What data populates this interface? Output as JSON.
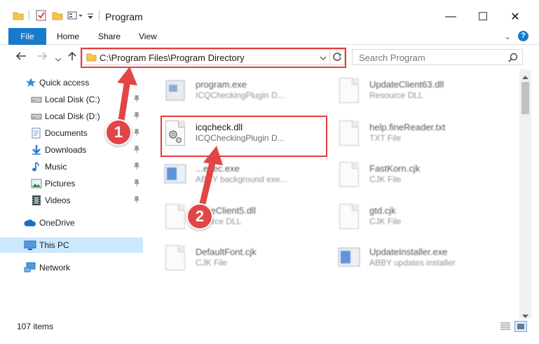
{
  "window": {
    "title": "Program",
    "minimize_glyph": "—",
    "maximize_glyph": "☐",
    "close_glyph": "✕"
  },
  "ribbon": {
    "tabs": [
      "File",
      "Home",
      "Share",
      "View"
    ],
    "help_glyph": "?",
    "expand_glyph": "⌄"
  },
  "address": {
    "path": "C:\\Program Files\\Program Directory",
    "search_placeholder": "Search Program"
  },
  "sidebar": {
    "items": [
      {
        "label": "Quick access",
        "icon": "star-icon",
        "pinned": false
      },
      {
        "label": "Local Disk (C:)",
        "icon": "drive-icon",
        "pinned": true
      },
      {
        "label": "Local Disk (D:)",
        "icon": "drive-icon",
        "pinned": true
      },
      {
        "label": "Documents",
        "icon": "documents-icon",
        "pinned": true
      },
      {
        "label": "Downloads",
        "icon": "download-arrow-icon",
        "pinned": true
      },
      {
        "label": "Music",
        "icon": "music-note-icon",
        "pinned": true
      },
      {
        "label": "Pictures",
        "icon": "pictures-icon",
        "pinned": true
      },
      {
        "label": "Videos",
        "icon": "film-icon",
        "pinned": true
      },
      {
        "label": "OneDrive",
        "icon": "cloud-icon",
        "pinned": false
      },
      {
        "label": "This PC",
        "icon": "monitor-icon",
        "pinned": false,
        "selected": true
      },
      {
        "label": "Network",
        "icon": "network-icon",
        "pinned": false
      }
    ]
  },
  "files": [
    {
      "name": "program.exe",
      "desc": "ICQCheckingPlugin D..."
    },
    {
      "name": "UpdateClient63.dll",
      "desc": "Resource DLL"
    },
    {
      "name": "icqcheck.dll",
      "desc": "ICQCheckingPlugin D...",
      "highlighted": true
    },
    {
      "name": "help.fineReader.txt",
      "desc": "TXT File"
    },
    {
      "name": "...exec.exe",
      "desc": "ABBY background exe..."
    },
    {
      "name": "FastKorn.cjk",
      "desc": "CJK File"
    },
    {
      "name": "...ateClient5.dll",
      "desc": "...ource DLL"
    },
    {
      "name": "gtd.cjk",
      "desc": "CJK File"
    },
    {
      "name": "DefaultFont.cjk",
      "desc": "CJK File"
    },
    {
      "name": "UpdateInstaller.exe",
      "desc": "ABBY updates installer"
    }
  ],
  "status": {
    "count": "107 items"
  },
  "annotations": {
    "step1": "1",
    "step2": "2"
  },
  "colors": {
    "accent": "#1979ca",
    "annotation_red": "#e24545",
    "selected_bg": "#cce8ff"
  }
}
